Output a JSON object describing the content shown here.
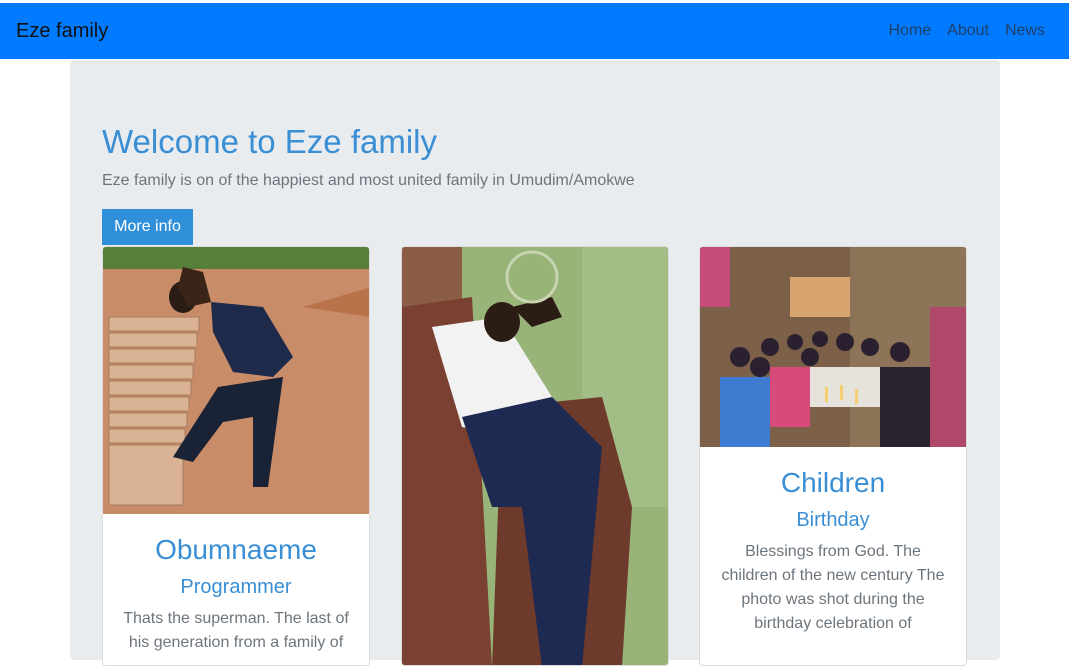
{
  "navbar": {
    "brand": "Eze family",
    "links": [
      "Home",
      "About",
      "News"
    ],
    "bg_color": "#007bff"
  },
  "jumbotron": {
    "title": "Welcome to Eze family",
    "lead": "Eze family is on of the happiest and most united family in Umudim/Amokwe",
    "button": "More info"
  },
  "cards": [
    {
      "title": "Obumnaeme",
      "subtitle": "Programmer",
      "text": "Thats the superman. The last of his generation from a family of",
      "image": "photo-man-posing"
    },
    {
      "title": "",
      "subtitle": "",
      "text": "",
      "image": "photo-man-on-couch"
    },
    {
      "title": "Children",
      "subtitle": "Birthday",
      "text": "Blessings from God. The children of the new century The photo was shot during the birthday celebration of",
      "image": "photo-children-birthday"
    }
  ]
}
